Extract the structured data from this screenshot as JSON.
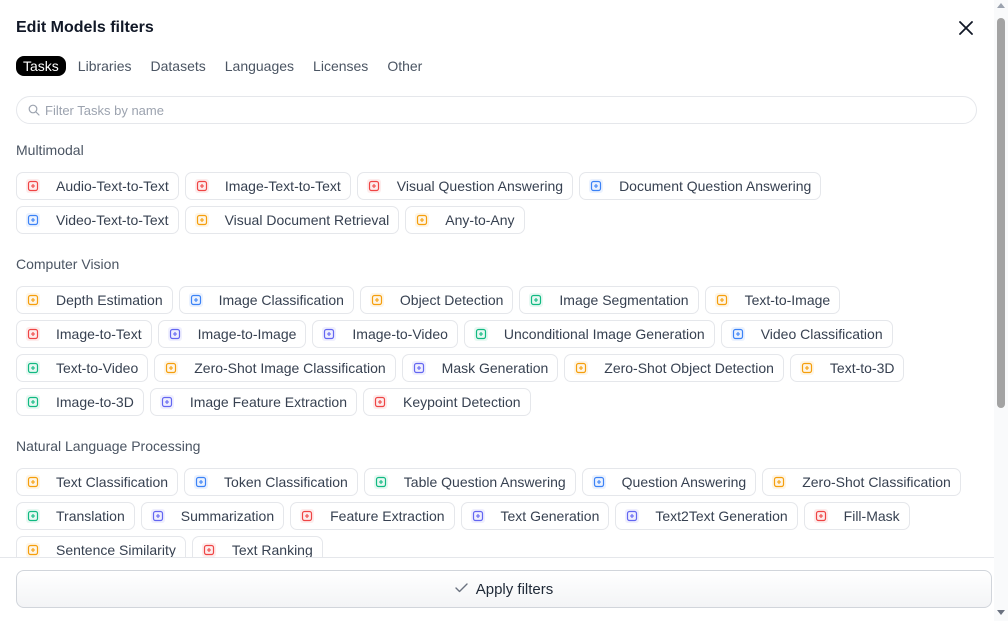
{
  "modal": {
    "title": "Edit Models filters"
  },
  "tabs": [
    {
      "label": "Tasks",
      "active": true
    },
    {
      "label": "Libraries"
    },
    {
      "label": "Datasets"
    },
    {
      "label": "Languages"
    },
    {
      "label": "Licenses"
    },
    {
      "label": "Other"
    }
  ],
  "search": {
    "placeholder": "Filter Tasks by name",
    "value": ""
  },
  "sections": [
    {
      "title": "Multimodal",
      "chips": [
        {
          "label": "Audio-Text-to-Text",
          "icon": "audio-text-icon",
          "color": "#ef4444"
        },
        {
          "label": "Image-Text-to-Text",
          "icon": "image-text-icon",
          "color": "#ef4444"
        },
        {
          "label": "Visual Question Answering",
          "icon": "visual-qa-icon",
          "color": "#ef4444"
        },
        {
          "label": "Document Question Answering",
          "icon": "document-qa-icon",
          "color": "#3b82f6"
        },
        {
          "label": "Video-Text-to-Text",
          "icon": "video-text-icon",
          "color": "#3b82f6"
        },
        {
          "label": "Visual Document Retrieval",
          "icon": "visual-doc-icon",
          "color": "#f59e0b"
        },
        {
          "label": "Any-to-Any",
          "icon": "any-to-any-icon",
          "color": "#f59e0b"
        }
      ]
    },
    {
      "title": "Computer Vision",
      "chips": [
        {
          "label": "Depth Estimation",
          "icon": "depth-icon",
          "color": "#f59e0b"
        },
        {
          "label": "Image Classification",
          "icon": "image-class-icon",
          "color": "#3b82f6"
        },
        {
          "label": "Object Detection",
          "icon": "object-det-icon",
          "color": "#f59e0b"
        },
        {
          "label": "Image Segmentation",
          "icon": "segmentation-icon",
          "color": "#10b981"
        },
        {
          "label": "Text-to-Image",
          "icon": "text-to-image-icon",
          "color": "#f59e0b"
        },
        {
          "label": "Image-to-Text",
          "icon": "image-to-text-icon",
          "color": "#ef4444"
        },
        {
          "label": "Image-to-Image",
          "icon": "image-to-image-icon",
          "color": "#6366f1"
        },
        {
          "label": "Image-to-Video",
          "icon": "image-to-video-icon",
          "color": "#6366f1"
        },
        {
          "label": "Unconditional Image Generation",
          "icon": "uncond-gen-icon",
          "color": "#10b981"
        },
        {
          "label": "Video Classification",
          "icon": "video-class-icon",
          "color": "#3b82f6"
        },
        {
          "label": "Text-to-Video",
          "icon": "text-to-video-icon",
          "color": "#10b981"
        },
        {
          "label": "Zero-Shot Image Classification",
          "icon": "zs-image-class-icon",
          "color": "#f59e0b"
        },
        {
          "label": "Mask Generation",
          "icon": "mask-gen-icon",
          "color": "#6366f1"
        },
        {
          "label": "Zero-Shot Object Detection",
          "icon": "zs-object-det-icon",
          "color": "#f59e0b"
        },
        {
          "label": "Text-to-3D",
          "icon": "text-to-3d-icon",
          "color": "#f59e0b"
        },
        {
          "label": "Image-to-3D",
          "icon": "image-to-3d-icon",
          "color": "#10b981"
        },
        {
          "label": "Image Feature Extraction",
          "icon": "image-feature-icon",
          "color": "#6366f1"
        },
        {
          "label": "Keypoint Detection",
          "icon": "keypoint-icon",
          "color": "#ef4444"
        }
      ]
    },
    {
      "title": "Natural Language Processing",
      "chips": [
        {
          "label": "Text Classification",
          "icon": "text-class-icon",
          "color": "#f59e0b"
        },
        {
          "label": "Token Classification",
          "icon": "token-class-icon",
          "color": "#3b82f6"
        },
        {
          "label": "Table Question Answering",
          "icon": "table-qa-icon",
          "color": "#10b981"
        },
        {
          "label": "Question Answering",
          "icon": "qa-icon",
          "color": "#3b82f6"
        },
        {
          "label": "Zero-Shot Classification",
          "icon": "zs-class-icon",
          "color": "#f59e0b"
        },
        {
          "label": "Translation",
          "icon": "translation-icon",
          "color": "#10b981"
        },
        {
          "label": "Summarization",
          "icon": "summarization-icon",
          "color": "#6366f1"
        },
        {
          "label": "Feature Extraction",
          "icon": "feature-extraction-icon",
          "color": "#ef4444"
        },
        {
          "label": "Text Generation",
          "icon": "text-generation-icon",
          "color": "#6366f1"
        },
        {
          "label": "Text2Text Generation",
          "icon": "text2text-icon",
          "color": "#6366f1"
        },
        {
          "label": "Fill-Mask",
          "icon": "fill-mask-icon",
          "color": "#ef4444"
        },
        {
          "label": "Sentence Similarity",
          "icon": "sentence-sim-icon",
          "color": "#f59e0b"
        },
        {
          "label": "Text Ranking",
          "icon": "text-ranking-icon",
          "color": "#ef4444"
        }
      ]
    }
  ],
  "apply": {
    "label": "Apply filters"
  }
}
